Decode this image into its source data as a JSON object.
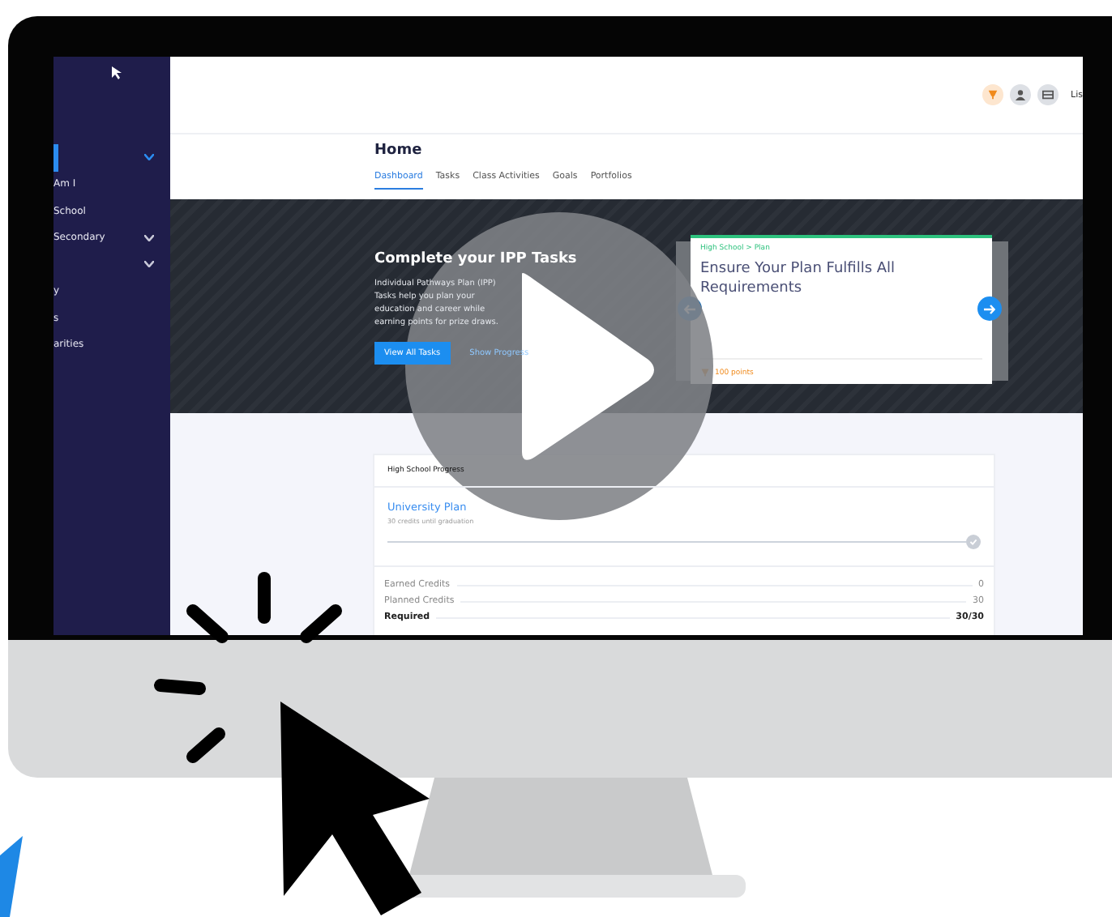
{
  "sidebar": {
    "items": [
      {
        "selected": true,
        "expandable": true
      },
      {
        "label": "Am I",
        "selected": false,
        "expandable": false
      },
      {
        "label": "School",
        "selected": false,
        "expandable": false
      },
      {
        "label": "Secondary",
        "selected": false,
        "expandable": true
      },
      {
        "selected": false,
        "expandable": true
      },
      {
        "label": "y",
        "selected": false,
        "expandable": false
      },
      {
        "label": "s",
        "selected": false,
        "expandable": false
      },
      {
        "label": "arities",
        "selected": false,
        "expandable": false
      }
    ]
  },
  "topbar": {
    "user": "Lis"
  },
  "page": {
    "title": "Home",
    "tabs": [
      {
        "label": "Dashboard",
        "selected": true
      },
      {
        "label": "Tasks",
        "selected": false
      },
      {
        "label": "Class Activities",
        "selected": false
      },
      {
        "label": "Goals",
        "selected": false
      },
      {
        "label": "Portfolios",
        "selected": false
      }
    ]
  },
  "banner": {
    "title": "Complete your IPP Tasks",
    "description": "Individual Pathways Plan (IPP) Tasks help you plan your education and career while earning points for prize draws.",
    "primary_button": "View All Tasks",
    "secondary_link": "Show Progress",
    "task_card": {
      "breadcrumb": "High School > Plan",
      "title": "Ensure Your Plan Fulfills All Requirements",
      "points": "100 points"
    }
  },
  "progress_card": {
    "header": "High School Progress",
    "plan": "University Plan",
    "subtitle": "30 credits until graduation",
    "rows": [
      {
        "label": "Earned Credits",
        "value": "0",
        "bold": false
      },
      {
        "label": "Planned Credits",
        "value": "30",
        "bold": false
      },
      {
        "label": "Required",
        "value": "30/30",
        "bold": true
      }
    ]
  }
}
